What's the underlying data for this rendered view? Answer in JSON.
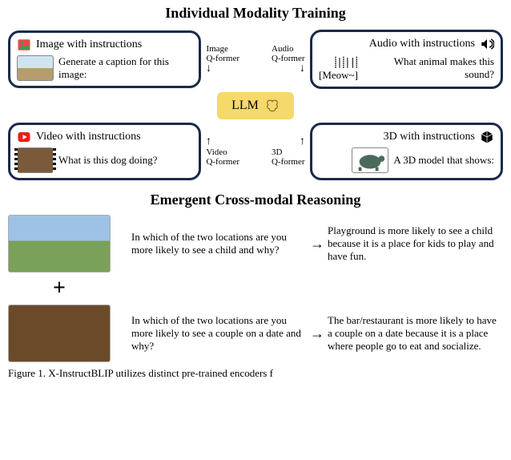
{
  "title_top": "Individual Modality Training",
  "boxes": {
    "image": {
      "header": "Image with instructions",
      "body": "Generate a caption for this image:"
    },
    "audio": {
      "header": "Audio with instructions",
      "body": "What animal makes this sound?",
      "wave": "[Meow~]"
    },
    "video": {
      "header": "Video with instructions",
      "body": "What is this dog doing?"
    },
    "threeD": {
      "header": "3D with instructions",
      "body": "A 3D model that shows:"
    }
  },
  "qformers": {
    "image": "Image\nQ-former",
    "audio": "Audio\nQ-former",
    "video": "Video\nQ-former",
    "threeD": "3D\nQ-former"
  },
  "llm": "LLM",
  "title_mid": "Emergent Cross-modal Reasoning",
  "emergent": {
    "q1": "In which of the two locations are you more likely to see a child and why?",
    "a1": "Playground is more likely to see a child because it is a place for kids to play and have fun.",
    "q2": "In which of the two locations are you more likely to see a couple on a date and why?",
    "a2": "The bar/restaurant is more likely to have a couple on a date because it is a place where people go to eat and socialize."
  },
  "caption": "Figure 1. X-InstructBLIP utilizes distinct pre-trained encoders f"
}
